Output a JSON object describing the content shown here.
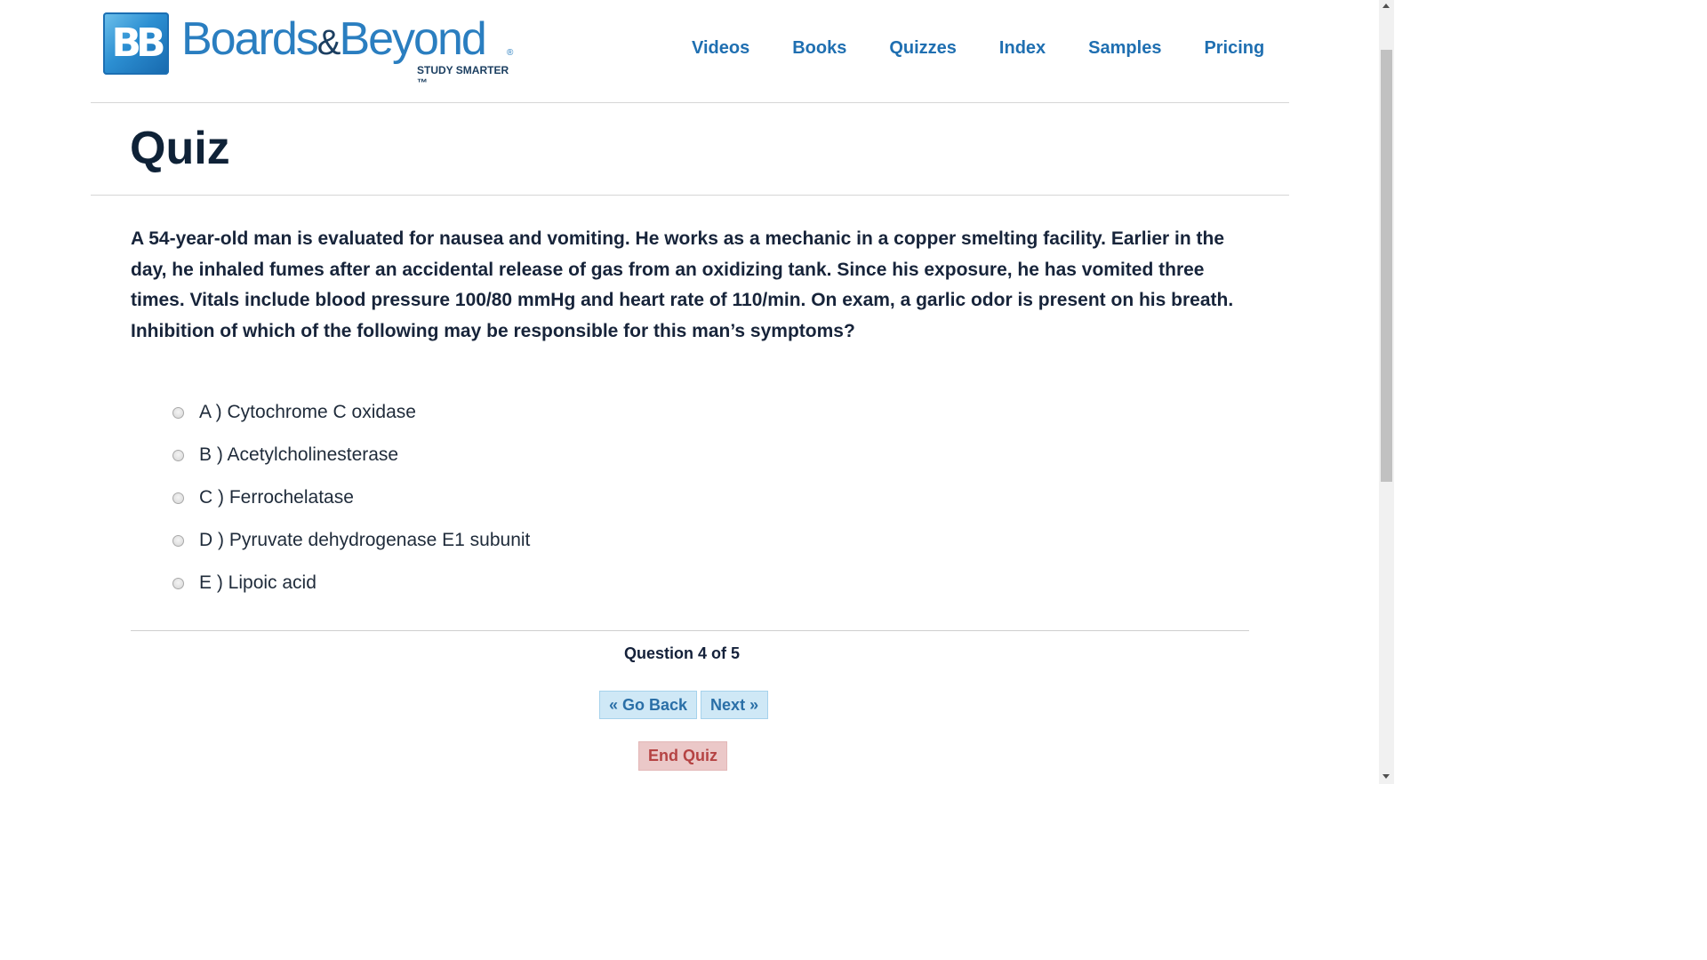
{
  "brand": {
    "mark": "BB",
    "name_part1": "Boards",
    "name_amp": "&",
    "name_part2": "Beyond",
    "registered": "®",
    "tagline": "STUDY SMARTER ™"
  },
  "nav": {
    "items": [
      {
        "label": "Videos"
      },
      {
        "label": "Books"
      },
      {
        "label": "Quizzes"
      },
      {
        "label": "Index"
      },
      {
        "label": "Samples"
      },
      {
        "label": "Pricing"
      }
    ]
  },
  "page": {
    "title": "Quiz"
  },
  "quiz": {
    "question": "A 54-year-old man is evaluated for nausea and vomiting. He works as a mechanic in a copper smelting facility. Earlier in the day, he inhaled fumes after an accidental release of gas from an oxidizing tank. Since his exposure, he has vomited three times. Vitals include blood pressure 100/80 mmHg and heart rate of 110/min. On exam, a garlic odor is present on his breath. Inhibition of which of the following may be responsible for this man’s symptoms?",
    "options": [
      {
        "label": "A ) Cytochrome C oxidase"
      },
      {
        "label": "B ) Acetylcholinesterase"
      },
      {
        "label": "C ) Ferrochelatase"
      },
      {
        "label": "D ) Pyruvate dehydrogenase E1 subunit"
      },
      {
        "label": "E ) Lipoic acid"
      }
    ],
    "progress_text": "Question 4 of 5",
    "back_label": "« Go Back",
    "next_label": "Next »",
    "end_label": "End Quiz"
  },
  "colors": {
    "brand_blue": "#2a7ec0",
    "nav_link": "#1f6fb1",
    "nav_button_bg": "#cfe8f6",
    "end_button_bg": "#ebc8c8",
    "end_button_text": "#b54343"
  },
  "icons": {
    "logo": "bb-logo-icon",
    "radio": "radio-unchecked-icon",
    "scroll_up": "scroll-up-arrow-icon",
    "scroll_down": "scroll-down-arrow-icon"
  }
}
